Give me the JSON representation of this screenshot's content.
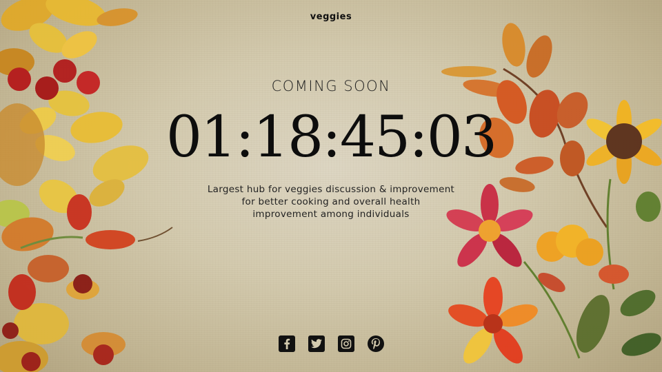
{
  "brand": "veggies",
  "heading": "COMING SOON",
  "countdown": {
    "hours_a": "01",
    "hours_b": "18",
    "minutes": "45",
    "seconds": "03",
    "separator": ":"
  },
  "description": [
    "Largest hub for veggies discussion & improvement",
    "for better cooking and overall health",
    "improvement among individuals"
  ],
  "social": [
    {
      "icon": "facebook-icon"
    },
    {
      "icon": "twitter-icon"
    },
    {
      "icon": "instagram-icon"
    },
    {
      "icon": "pinterest-icon"
    }
  ],
  "colors": {
    "background": "#d3caae",
    "text": "#111111"
  }
}
